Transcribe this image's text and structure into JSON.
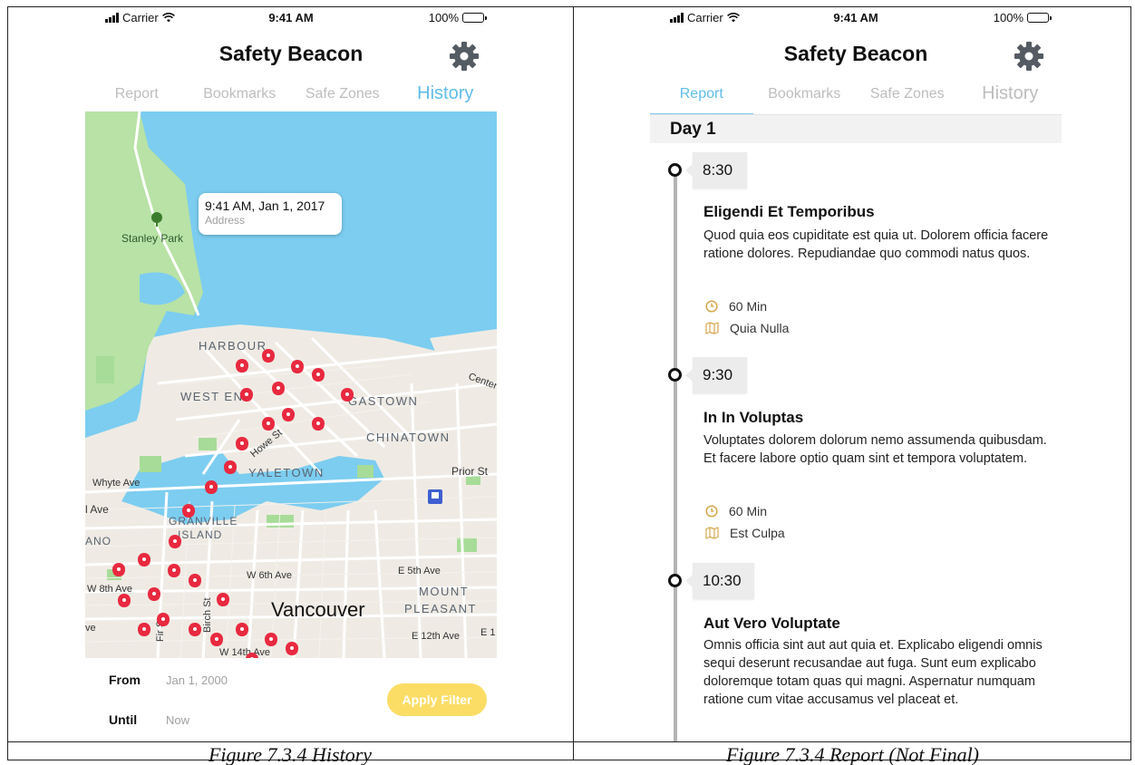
{
  "status_bar": {
    "carrier": "Carrier",
    "time": "9:41 AM",
    "battery": "100%"
  },
  "app": {
    "title": "Safety Beacon"
  },
  "tabs": [
    {
      "label": "Report"
    },
    {
      "label": "Bookmarks"
    },
    {
      "label": "Safe Zones"
    },
    {
      "label": "History"
    }
  ],
  "history_screen": {
    "active_tab": "History",
    "map": {
      "tooltip": {
        "time": "9:41 AM, Jan 1, 2017",
        "subtitle": "Address"
      },
      "labels": {
        "stanley_park": "Stanley Park",
        "harbour": "HARBOUR",
        "west_end": "WEST END",
        "gastown": "GASTOWN",
        "chinatown": "CHINATOWN",
        "yaletown": "YALETOWN",
        "howe_st": "Howe St",
        "granville": "GRANVILLE",
        "island": "ISLAND",
        "prior_st": "Prior St",
        "whyte_ave": "Whyte Ave",
        "ave": "l Ave",
        "ano": "ANO",
        "w6": "W 6th Ave",
        "e5": "E 5th Ave",
        "w8": "W 8th Ave",
        "mount": "MOUNT",
        "pleasant": "PLEASANT",
        "vancouver": "Vancouver",
        "birch": "Birch St",
        "fir": "Fir St",
        "ve": "ve",
        "e12": "E 12th Ave",
        "e1": "E 1",
        "w14": "W 14th Ave",
        "center": "Center"
      },
      "colors": {
        "water": "#7ccdf0",
        "land": "#efebe4",
        "park": "#a7dc98",
        "road": "#ffffff",
        "pin": "#e8293f"
      }
    },
    "filter": {
      "from_label": "From",
      "from_value": "Jan 1, 2000",
      "until_label": "Until",
      "until_value": "Now",
      "apply_label": "Apply Filter"
    }
  },
  "report_screen": {
    "active_tab": "Report",
    "day_label": "Day 1",
    "events": [
      {
        "time": "8:30",
        "title": "Eligendi Et Temporibus",
        "description": "Quod quia eos cupiditate est quia ut. Dolorem officia facere ratione dolores. Repudiandae quo commodi natus quos.",
        "duration": "60 Min",
        "location": "Quia Nulla"
      },
      {
        "time": "9:30",
        "title": "In In Voluptas",
        "description": "Voluptates dolorem dolorum nemo assumenda quibusdam. Et facere labore optio quam sint et tempora voluptatem.",
        "duration": "60 Min",
        "location": "Est Culpa"
      },
      {
        "time": "10:30",
        "title": "Aut Vero Voluptate",
        "description": "Omnis officia sint aut aut quia et. Explicabo eligendi omnis sequi deserunt recusandae aut fuga. Sunt eum explicabo doloremque totam quas qui magni. Aspernatur numquam ratione cum vitae accusamus vel placeat et."
      }
    ]
  },
  "captions": {
    "left": "Figure 7.3.4 History",
    "right": "Figure 7.3.4 Report (Not Final)"
  }
}
